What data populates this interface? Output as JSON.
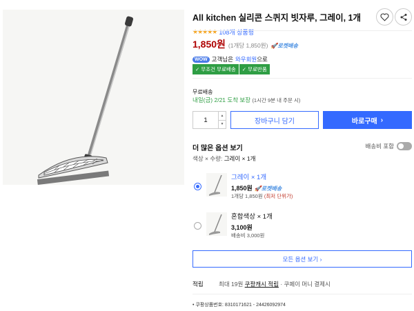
{
  "product": {
    "title": "All kitchen 실리콘 스퀴지 빗자루, 그레이, 1개",
    "stars": "★★★★★",
    "review_count": "108개 상품평"
  },
  "pricing": {
    "price": "1,850원",
    "unit_price": "(1개당 1,850원)",
    "rocket_label": "로켓배송"
  },
  "wow": {
    "badge": "WOW",
    "text_prefix": "고객님은",
    "member_link": "와우회원",
    "text_suffix": "으로"
  },
  "benefits": [
    "✓ 무조건 무료배송",
    "✓ 무료반품"
  ],
  "shipping": {
    "label": "무료배송",
    "date": "내일(금) 2/21",
    "guarantee": "도착 보장",
    "note": "(1시간 9분 내 주문 시)"
  },
  "purchase": {
    "quantity": "1",
    "cart_label": "장바구니 담기",
    "buy_label": "바로구매",
    "buy_arrow": "›"
  },
  "options": {
    "title": "더 많은 옵션 보기",
    "shipping_toggle_label": "배송비 포함",
    "selection_prefix": "색상 × 수량:",
    "selection_value": "그레이 × 1개",
    "items": [
      {
        "name": "그레이 × 1개",
        "price": "1,850원",
        "badge": "로켓배송",
        "sub": "1개당 1,850원",
        "sub_note": "(최저 단위가)",
        "selected": true
      },
      {
        "name": "혼합색상 × 1개",
        "price": "3,100원",
        "badge": "",
        "sub": "배송비 3,000원",
        "sub_note": "",
        "selected": false
      }
    ],
    "all_options_label": "모든 옵션 보기 ›"
  },
  "points": {
    "label": "적립",
    "prefix": "최대 19원",
    "link": "쿠팡캐시 적립",
    "suffix": " · 쿠페이 머니 결제시"
  },
  "product_code": "• 쿠팡상품번호: 8310171621 - 24426092974",
  "colors": {
    "accent": "#346aff",
    "price": "#ae0000",
    "benefit_green": "#2f9e44",
    "wow_blue": "#4a7be8"
  },
  "icons": [
    "heart-icon",
    "share-icon",
    "rocket-icon",
    "check-icon"
  ]
}
